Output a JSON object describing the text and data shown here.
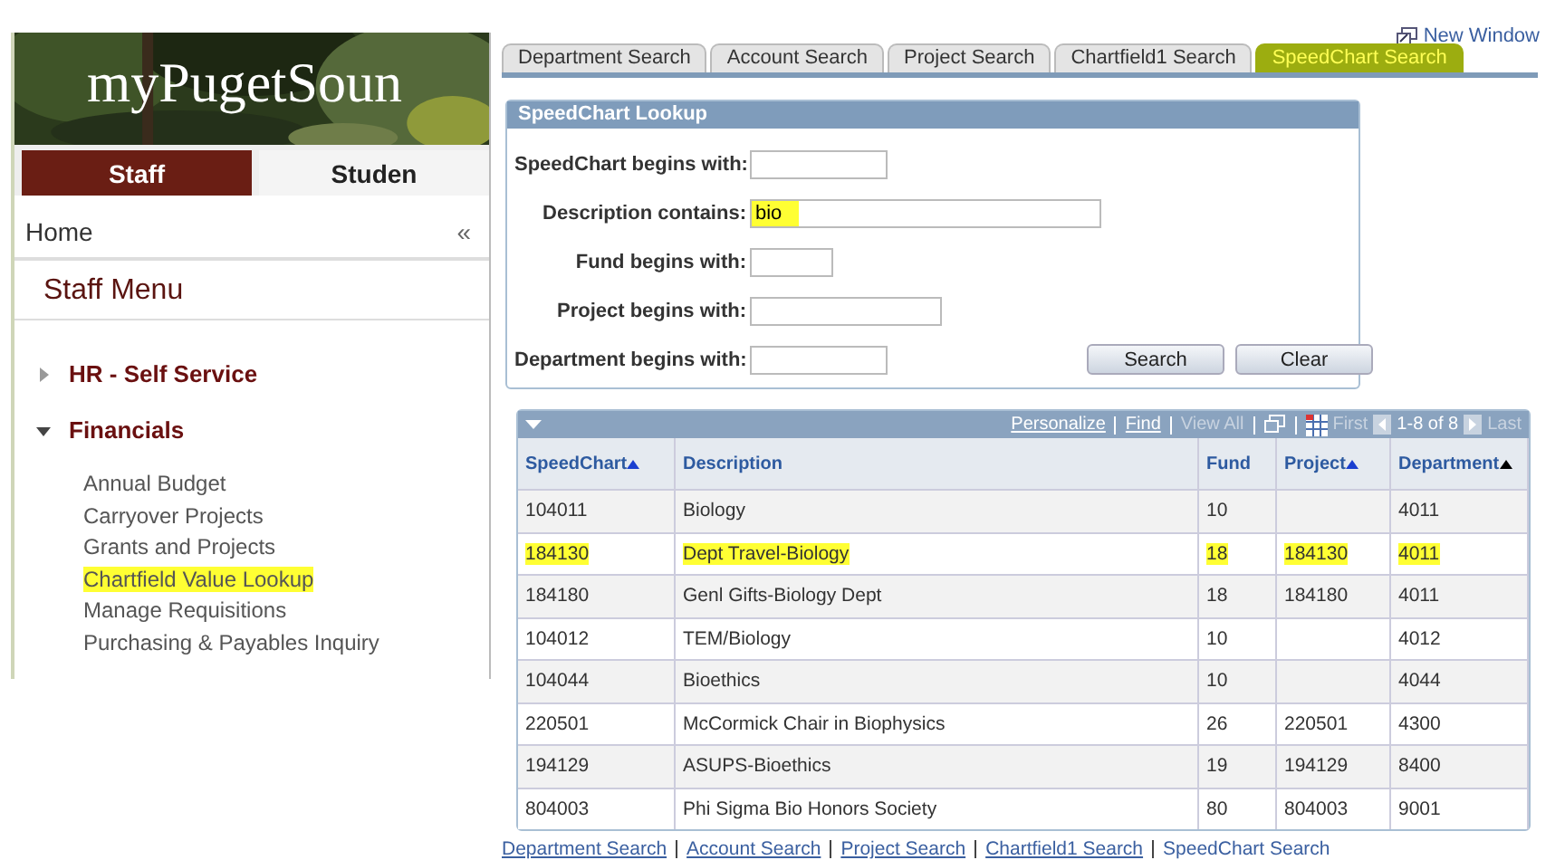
{
  "portal": {
    "logo": "myPugetSoun",
    "tabs": [
      {
        "label": "Staff",
        "selected": true
      },
      {
        "label": "Studen",
        "selected": false
      }
    ],
    "home": "Home",
    "collapse": "«",
    "menu_title": "Staff Menu",
    "sections": [
      {
        "label": "HR - Self Service",
        "expanded": false
      },
      {
        "label": "Financials",
        "expanded": true,
        "children": [
          {
            "label": "Annual Budget",
            "highlighted": false
          },
          {
            "label": "Carryover Projects",
            "highlighted": false
          },
          {
            "label": "Grants and Projects",
            "highlighted": false
          },
          {
            "label": "Chartfield Value Lookup",
            "highlighted": true
          },
          {
            "label": "Manage Requisitions",
            "highlighted": false
          },
          {
            "label": "Purchasing & Payables Inquiry",
            "highlighted": false
          }
        ]
      }
    ]
  },
  "new_window": "New Window",
  "tabs": [
    {
      "label": "Department Search",
      "selected": false
    },
    {
      "label": "Account Search",
      "selected": false
    },
    {
      "label": "Project Search",
      "selected": false
    },
    {
      "label": "Chartfield1 Search",
      "selected": false
    },
    {
      "label": "SpeedChart Search",
      "selected": true
    }
  ],
  "lookup": {
    "title": "SpeedChart Lookup",
    "fields": [
      {
        "label": "SpeedChart begins with:",
        "highlighted": false
      },
      {
        "label": "Description contains:",
        "value": "bio",
        "highlighted": true
      },
      {
        "label": "Fund begins with:",
        "highlighted": false
      },
      {
        "label": "Project begins with:",
        "highlighted": false
      },
      {
        "label": "Department begins with:",
        "highlighted": false
      }
    ],
    "buttons": [
      "Search",
      "Clear"
    ]
  },
  "grid": {
    "links": [
      {
        "label": "Personalize",
        "enabled": true
      },
      {
        "label": "Find",
        "enabled": true
      },
      {
        "label": "View All",
        "enabled": false
      }
    ],
    "nav": {
      "first": "First",
      "range": "1-8 of 8",
      "last": "Last"
    },
    "columns": [
      {
        "label": "SpeedChart",
        "sort_arrow": true,
        "color": "#1a3fd0"
      },
      {
        "label": "Description",
        "sort_arrow": false
      },
      {
        "label": "Fund",
        "sort_arrow": false
      },
      {
        "label": "Project",
        "sort_arrow": true,
        "color": "#1a3fd0"
      },
      {
        "label": "Department",
        "sort_arrow": true,
        "color": "#000000"
      }
    ],
    "rows": [
      {
        "cells": [
          "104011",
          "Biology",
          "10",
          "",
          "4011"
        ],
        "highlighted": false
      },
      {
        "cells": [
          "184130",
          "Dept Travel-Biology",
          "18",
          "184130",
          "4011"
        ],
        "highlighted": true
      },
      {
        "cells": [
          "184180",
          "Genl Gifts-Biology Dept",
          "18",
          "184180",
          "4011"
        ],
        "highlighted": false
      },
      {
        "cells": [
          "104012",
          "TEM/Biology",
          "10",
          "",
          "4012"
        ],
        "highlighted": false
      },
      {
        "cells": [
          "104044",
          "Bioethics",
          "10",
          "",
          "4044"
        ],
        "highlighted": false
      },
      {
        "cells": [
          "220501",
          "McCormick Chair in Biophysics",
          "26",
          "220501",
          "4300"
        ],
        "highlighted": false
      },
      {
        "cells": [
          "194129",
          "ASUPS-Bioethics",
          "19",
          "194129",
          "8400"
        ],
        "highlighted": false
      },
      {
        "cells": [
          "804003",
          "Phi Sigma Bio Honors Society",
          "80",
          "804003",
          "9001"
        ],
        "highlighted": false
      }
    ]
  },
  "footer_links": [
    {
      "label": "Department Search",
      "link": true
    },
    {
      "label": "Account Search",
      "link": true
    },
    {
      "label": "Project Search",
      "link": true
    },
    {
      "label": "Chartfield1 Search",
      "link": true
    },
    {
      "label": "SpeedChart Search",
      "link": false
    }
  ]
}
